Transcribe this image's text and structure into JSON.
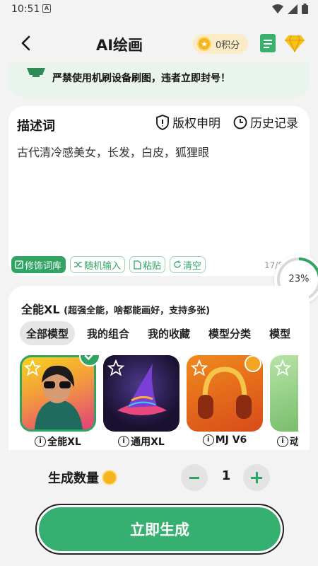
{
  "status_bar": {
    "time": "10:51",
    "notification_letter": "A"
  },
  "header": {
    "title": "AI绘画",
    "points_label": "0积分"
  },
  "warning": {
    "text": "严禁使用机刷设备刷图，违者立即封号！"
  },
  "description": {
    "label": "描述词",
    "copyright_label": "版权申明",
    "history_label": "历史记录",
    "text": "古代清冷感美女，长发，白皮，狐狸眼",
    "tags": [
      "修饰词库",
      "随机输入",
      "粘贴",
      "清空"
    ],
    "char_count": "17/800"
  },
  "progress": {
    "label": "23%",
    "percent": 23
  },
  "models": {
    "title": "全能XL",
    "subtitle": "(超强全能，啥都能画好，支持多张)",
    "tabs": [
      "全部模型",
      "我的组合",
      "我的收藏",
      "模型分类",
      "模型"
    ],
    "items": [
      {
        "name": "全能XL",
        "selected": true,
        "starred": false
      },
      {
        "name": "通用XL",
        "selected": false,
        "starred": false
      },
      {
        "name": "MJ V6",
        "selected": false,
        "starred": true
      },
      {
        "name": "动",
        "selected": false,
        "starred": false
      }
    ]
  },
  "count": {
    "label": "生成数量",
    "value": "1"
  },
  "generate_button": {
    "label": "立即生成"
  },
  "colors": {
    "accent": "#35b070",
    "warning_bg": "#e9f4ec",
    "gold": "#f5b51e"
  }
}
